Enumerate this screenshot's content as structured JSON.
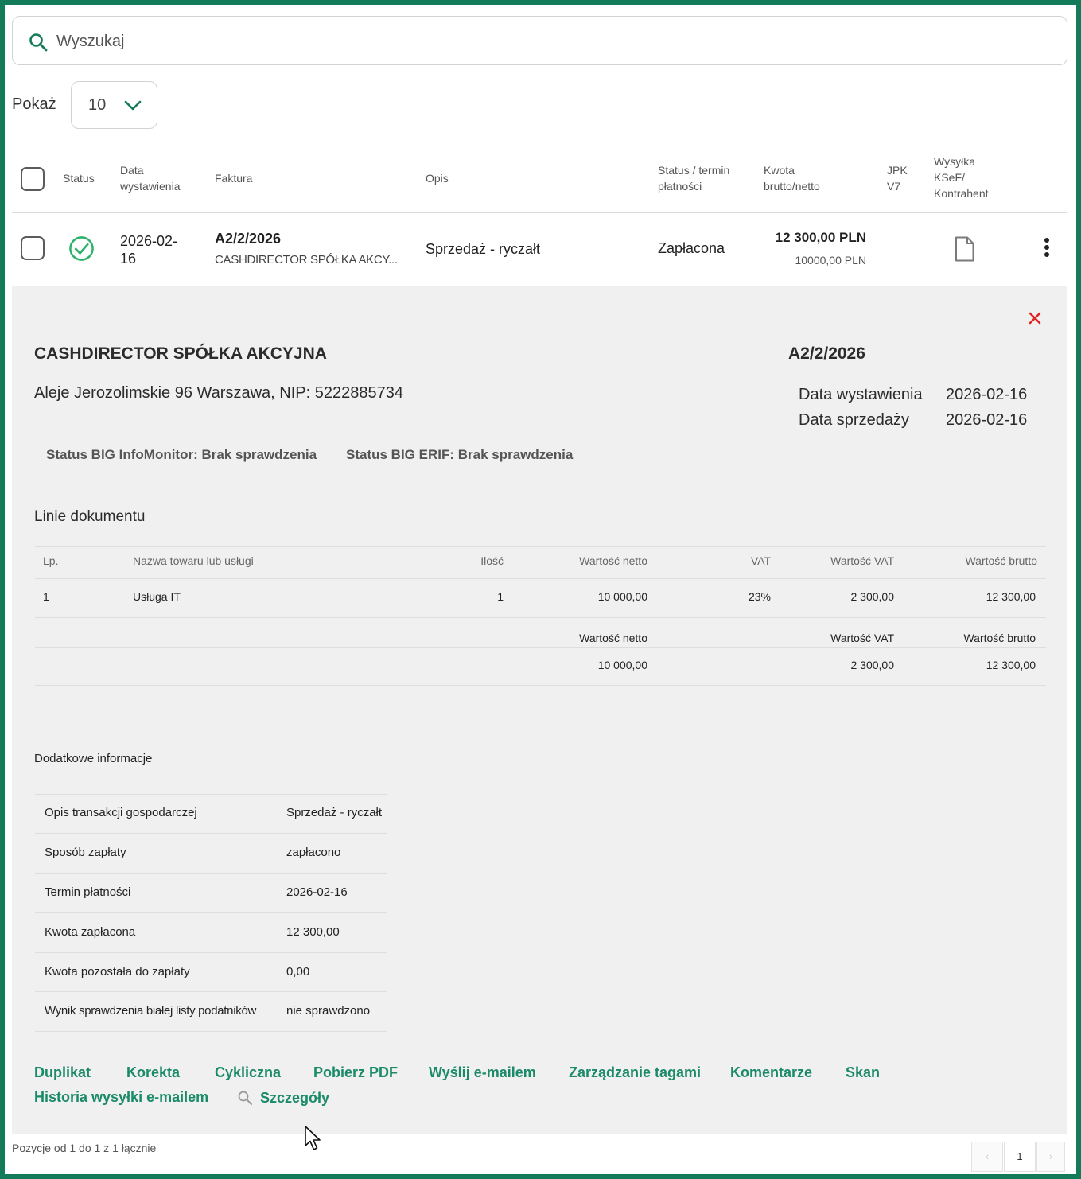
{
  "search": {
    "placeholder": "Wyszukaj"
  },
  "pagination_size": {
    "label": "Pokaż",
    "value": "10"
  },
  "table": {
    "headers": {
      "status": "Status",
      "date_line1": "Data",
      "date_line2": "wystawienia",
      "invoice": "Faktura",
      "description": "Opis",
      "payment_line1": "Status / termin",
      "payment_line2": "płatności",
      "amount_line1": "Kwota",
      "amount_line2": "brutto/netto",
      "jpk_line1": "JPK",
      "jpk_line2": "V7",
      "ksef_line1": "Wysyłka",
      "ksef_line2": "KSeF/",
      "ksef_line3": "Kontrahent"
    },
    "row": {
      "date_line1": "2026-02-",
      "date_line2": "16",
      "invoice_number": "A2/2/2026",
      "client_short": "CASHDIRECTOR SPÓŁKA AKCY...",
      "description": "Sprzedaż - ryczałt",
      "payment_status": "Zapłacona",
      "gross": "12 300,00 PLN",
      "net": "10000,00 PLN"
    }
  },
  "details": {
    "company": "CASHDIRECTOR SPÓŁKA AKCYJNA",
    "address": "Aleje Jerozolimskie 96 Warszawa, NIP: 5222885734",
    "invoice_number": "A2/2/2026",
    "issue_date_label": "Data wystawienia",
    "issue_date": "2026-02-16",
    "sale_date_label": "Data sprzedaży",
    "sale_date": "2026-02-16",
    "big_infomonitor": "Status BIG InfoMonitor: Brak sprawdzenia",
    "big_erif": "Status BIG ERIF: Brak sprawdzenia",
    "lines_title": "Linie dokumentu",
    "lines_headers": {
      "lp": "Lp.",
      "name": "Nazwa towaru lub usługi",
      "qty": "Ilość",
      "net": "Wartość netto",
      "vat": "VAT",
      "vat_value": "Wartość VAT",
      "gross": "Wartość brutto"
    },
    "line": {
      "lp": "1",
      "name": "Usługa IT",
      "qty": "1",
      "net": "10 000,00",
      "vat": "23%",
      "vat_value": "2 300,00",
      "gross": "12 300,00"
    },
    "totals_headers": {
      "net": "Wartość netto",
      "vat_value": "Wartość VAT",
      "gross": "Wartość brutto"
    },
    "totals": {
      "net": "10 000,00",
      "vat_value": "2 300,00",
      "gross": "12 300,00"
    },
    "extra_title": "Dodatkowe informacje",
    "extra": [
      {
        "key": "Opis transakcji gospodarczej",
        "value": "Sprzedaż - ryczałt"
      },
      {
        "key": "Sposób zapłaty",
        "value": "zapłacono"
      },
      {
        "key": "Termin płatności",
        "value": "2026-02-16"
      },
      {
        "key": "Kwota zapłacona",
        "value": "12 300,00"
      },
      {
        "key": "Kwota pozostała do zapłaty",
        "value": "0,00"
      },
      {
        "key": "Wynik sprawdzenia białej listy podatników",
        "value": "nie sprawdzono"
      }
    ],
    "actions": {
      "duplicate": "Duplikat",
      "correction": "Korekta",
      "cyclic": "Cykliczna",
      "download_pdf": "Pobierz PDF",
      "send_email": "Wyślij e-mailem",
      "tags": "Zarządzanie tagami",
      "comments": "Komentarze",
      "scan": "Skan",
      "email_history": "Historia wysyłki e-mailem",
      "details": "Szczegóły"
    }
  },
  "footer": {
    "summary": "Pozycje od 1 do 1 z 1 łącznie",
    "prev": "‹",
    "page": "1",
    "next": "›"
  },
  "colors": {
    "accent": "#137a5a",
    "link": "#1a8a69",
    "status_ok": "#2fb36b",
    "close": "#e02424",
    "panel_bg": "#f0f0f0"
  }
}
